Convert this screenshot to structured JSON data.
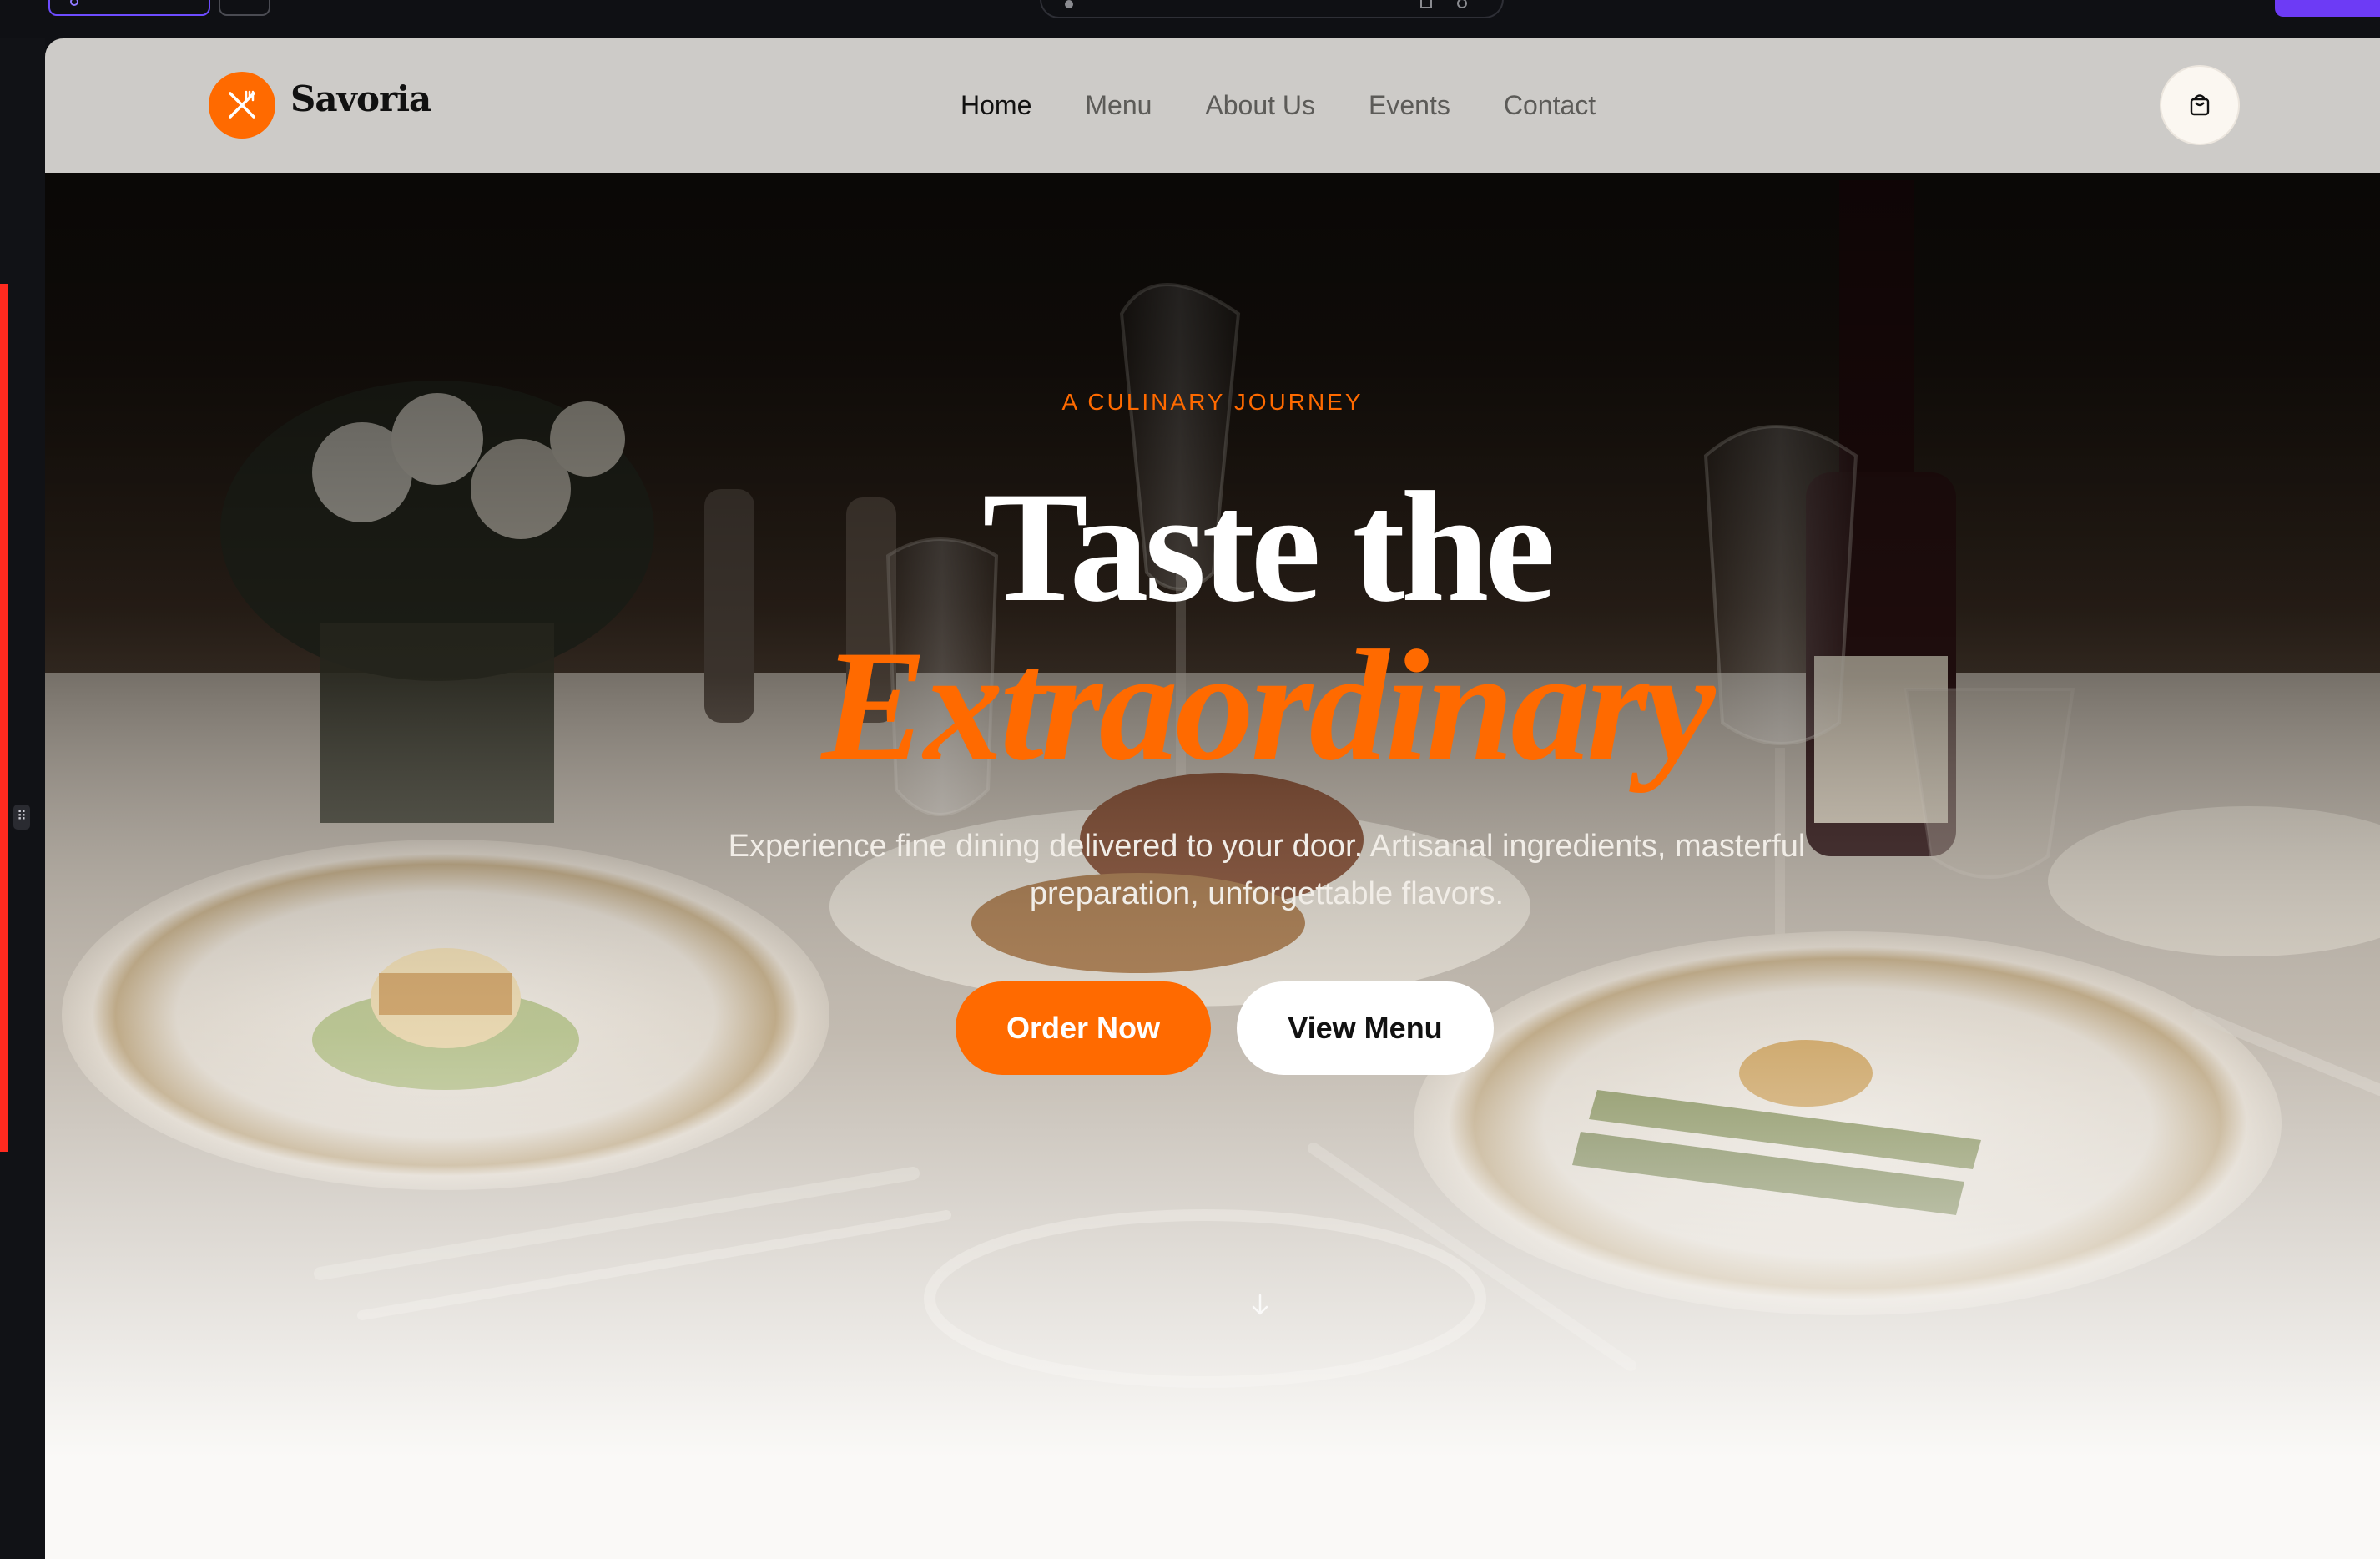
{
  "site": {
    "brand": "Savoria",
    "accent": "#ff6a00",
    "nav": {
      "items": [
        {
          "label": "Home",
          "active": true
        },
        {
          "label": "Menu",
          "active": false
        },
        {
          "label": "About Us",
          "active": false
        },
        {
          "label": "Events",
          "active": false
        },
        {
          "label": "Contact",
          "active": false
        }
      ],
      "cart_icon": "shopping-bag-icon"
    },
    "hero": {
      "eyebrow": "A CULINARY JOURNEY",
      "headline_line1": "Taste the",
      "headline_line2": "Extraordinary",
      "subtitle": "Experience fine dining delivered to your door. Artisanal ingredients, masterful preparation, unforgettable flavors.",
      "primary_button": "Order Now",
      "secondary_button": "View Menu",
      "scroll_icon": "arrow-down-icon"
    }
  },
  "editor": {
    "drag_handle_glyph": "⠿",
    "accent_purple": "#6d3bf5",
    "selection_color": "#ff2a1f"
  }
}
